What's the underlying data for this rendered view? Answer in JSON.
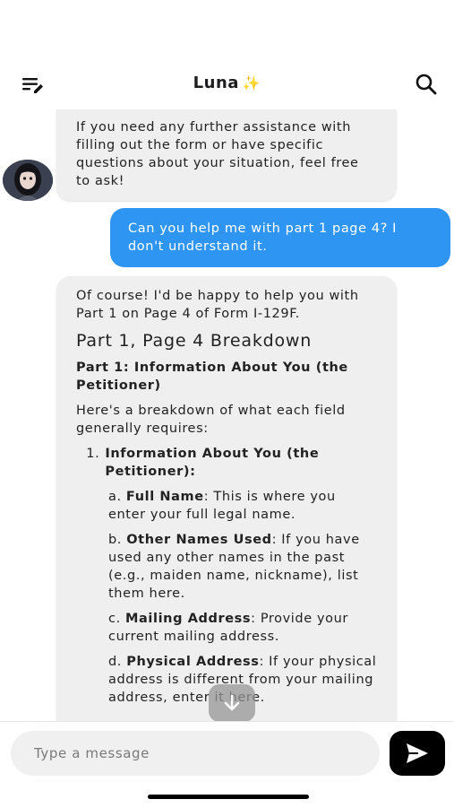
{
  "header": {
    "title": "Luna",
    "title_emoji": "✨",
    "menu_icon": "list-edit-icon",
    "search_icon": "search-icon"
  },
  "messages": {
    "ai_1": {
      "text": "If you need any further assistance with filling out the form or have specific questions about your situation, feel free to ask!"
    },
    "user_1": {
      "text": "Can you help me with part 1 page 4? I don't understand it."
    },
    "ai_2": {
      "intro": "Of course! I'd be happy to help you with Part 1 on Page 4 of Form I-129F.",
      "heading": "Part 1, Page 4 Breakdown",
      "subheading": "Part 1: Information About You (the Petitioner)",
      "lead": "Here's a breakdown of what each field generally requires:",
      "list_number": "1.",
      "list_title": "Information About You (the Petitioner):",
      "items": [
        {
          "prefix": "a.",
          "label": "Full Name",
          "text": ": This is where you enter your full legal name."
        },
        {
          "prefix": "b.",
          "label": "Other Names Used",
          "text": ": If you have used any other names in the past (e.g., maiden name, nickname), list them here."
        },
        {
          "prefix": "c.",
          "label": "Mailing Address",
          "text": ": Provide your current mailing address."
        },
        {
          "prefix": "d.",
          "label": "Physical Address",
          "text": ": If your physical address is different from your mailing address, enter it here."
        }
      ]
    }
  },
  "composer": {
    "placeholder": "Type a message",
    "value": ""
  },
  "colors": {
    "user_bubble": "#2f95f2",
    "ai_bubble": "#efefef",
    "send_button": "#000000"
  }
}
